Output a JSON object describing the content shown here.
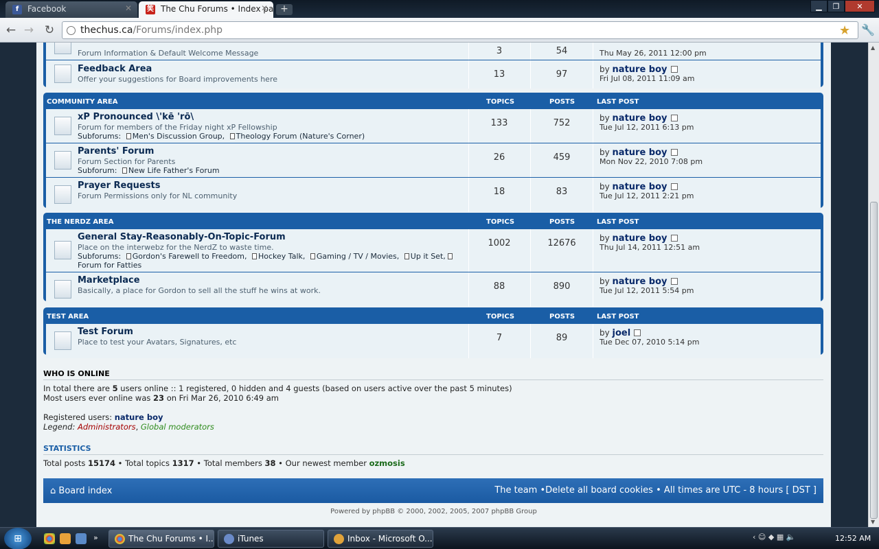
{
  "browser": {
    "tabs": [
      {
        "label": "Facebook",
        "favicon": "f"
      },
      {
        "label": "The Chu Forums • Index pa",
        "favicon": "笑"
      }
    ],
    "url_host": "thechus.ca",
    "url_path": "/Forums/index.php"
  },
  "blocks": [
    {
      "category": "",
      "forums": [
        {
          "title": "",
          "description": "Forum Information & Default Welcome Message",
          "topics": "3",
          "posts": "54",
          "last_user": "",
          "last_date": "Thu May 26, 2011 12:00 pm"
        },
        {
          "title": "Feedback Area",
          "description": "Offer your suggestions for Board improvements here",
          "topics": "13",
          "posts": "97",
          "last_user": "nature boy",
          "last_date": "Fri Jul 08, 2011 11:09 am"
        }
      ]
    },
    {
      "category": "COMMUNITY AREA",
      "headers": {
        "topics": "TOPICS",
        "posts": "POSTS",
        "last_post": "LAST POST"
      },
      "forums": [
        {
          "title": "xP Pronounced \\'kē 'rō\\",
          "description": "Forum for members of the Friday night xP Fellowship",
          "subforums_label": "Subforums:",
          "subforums": [
            "Men's Discussion Group,",
            "Theology Forum (Nature's Corner)"
          ],
          "topics": "133",
          "posts": "752",
          "last_user": "nature boy",
          "last_date": "Tue Jul 12, 2011 6:13 pm"
        },
        {
          "title": "Parents' Forum",
          "description": "Forum Section for Parents",
          "subforums_label": "Subforum:",
          "subforums": [
            "New Life Father's Forum"
          ],
          "topics": "26",
          "posts": "459",
          "last_user": "nature boy",
          "last_date": "Mon Nov 22, 2010 7:08 pm"
        },
        {
          "title": "Prayer Requests",
          "description": "Forum Permissions only for NL community",
          "topics": "18",
          "posts": "83",
          "last_user": "nature boy",
          "last_date": "Tue Jul 12, 2011 2:21 pm"
        }
      ]
    },
    {
      "category": "THE NERDZ AREA",
      "headers": {
        "topics": "TOPICS",
        "posts": "POSTS",
        "last_post": "LAST POST"
      },
      "forums": [
        {
          "title": "General Stay-Reasonably-On-Topic-Forum",
          "description": "Place on the interwebz for the NerdZ to waste time.",
          "subforums_label": "Subforums:",
          "subforums": [
            "Gordon's Farewell to Freedom,",
            "Hockey Talk,",
            "Gaming / TV / Movies,",
            "Up it Set,",
            "Forum for Fatties"
          ],
          "topics": "1002",
          "posts": "12676",
          "last_user": "nature boy",
          "last_date": "Thu Jul 14, 2011 12:51 am"
        },
        {
          "title": "Marketplace",
          "description": "Basically, a place for Gordon to sell all the stuff he wins at work.",
          "topics": "88",
          "posts": "890",
          "last_user": "nature boy",
          "last_date": "Tue Jul 12, 2011 5:54 pm"
        }
      ]
    },
    {
      "category": "TEST AREA",
      "headers": {
        "topics": "TOPICS",
        "posts": "POSTS",
        "last_post": "LAST POST"
      },
      "forums": [
        {
          "title": "Test Forum",
          "description": "Place to test your Avatars, Signatures, etc",
          "topics": "7",
          "posts": "89",
          "last_user": "joel",
          "last_date": "Tue Dec 07, 2010 5:14 pm"
        }
      ]
    }
  ],
  "by": "by",
  "online": {
    "title": "WHO IS ONLINE",
    "line1_a": "In total there are ",
    "total": "5",
    "line1_b": " users online :: 1 registered, 0 hidden and 4 guests (based on users active over the past 5 minutes)",
    "line2_a": "Most users ever online was ",
    "max": "23",
    "line2_b": " on Fri Mar 26, 2010 6:49 am",
    "registered_label": "Registered users: ",
    "registered_user": "nature boy",
    "legend_label": "Legend: ",
    "legend_admin": "Administrators",
    "legend_sep": ", ",
    "legend_gmod": "Global moderators"
  },
  "stats": {
    "title": "STATISTICS",
    "posts_label": "Total posts ",
    "posts": "15174",
    "topics_label": " • Total topics ",
    "topics": "1317",
    "members_label": " • Total members ",
    "members": "38",
    "newest_label": " • Our newest member ",
    "newest": "ozmosis"
  },
  "footer": {
    "board_index": "Board index",
    "right": "The team •Delete all board cookies • All times are UTC - 8 hours [ DST ]",
    "powered": "Powered by phpBB © 2000, 2002, 2005, 2007 phpBB Group"
  },
  "taskbar": {
    "items": [
      "The Chu Forums • I...",
      "iTunes",
      "Inbox - Microsoft O..."
    ],
    "clock": "12:52 AM"
  },
  "colors": {
    "forum_blue": "#1a5ea6",
    "admin": "#a40000",
    "gmod": "#2e8b1c"
  }
}
